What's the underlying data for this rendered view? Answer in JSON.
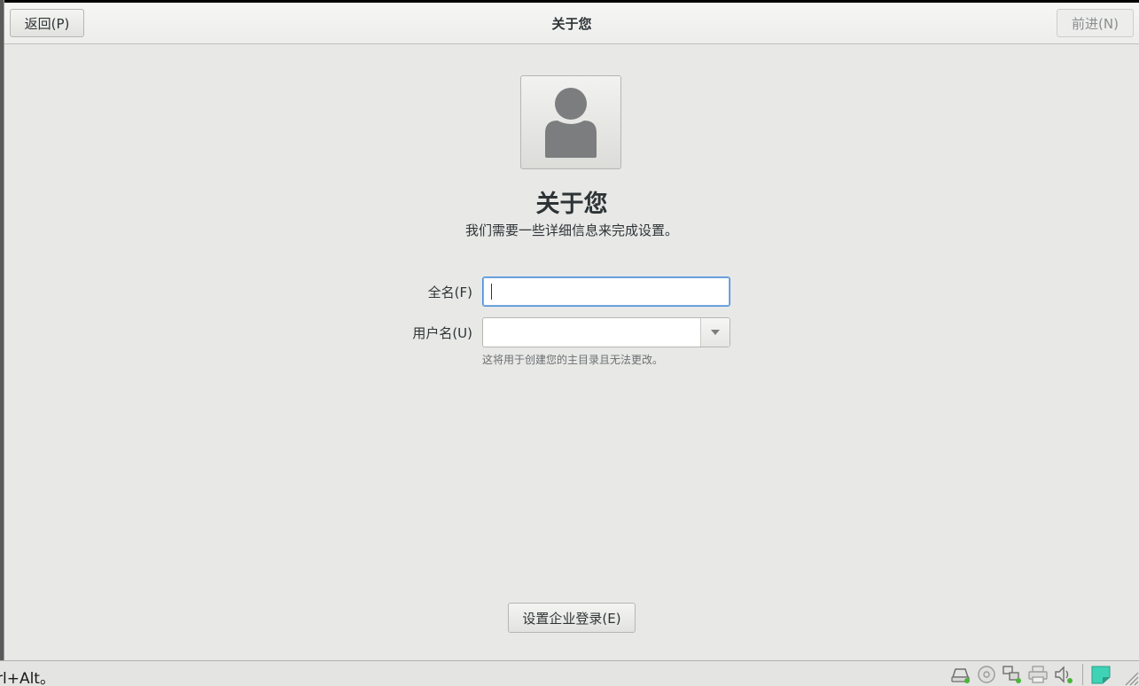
{
  "header": {
    "back_label": "返回(P)",
    "title": "关于您",
    "next_label": "前进(N)"
  },
  "main": {
    "heading": "关于您",
    "subtitle": "我们需要一些详细信息来完成设置。",
    "fullname": {
      "label": "全名(F)",
      "value": ""
    },
    "username": {
      "label": "用户名(U)",
      "value": "",
      "hint": "这将用于创建您的主目录且无法更改。"
    },
    "enterprise_login_label": "设置企业登录(E)"
  },
  "statusbar": {
    "hint_text": "rl+Alt。",
    "icons": [
      "hard-disk-icon",
      "optical-disc-icon",
      "network-icon",
      "printer-icon",
      "audio-icon",
      "shared-clipboard-icon"
    ]
  },
  "colors": {
    "focus_border": "#4a90d9",
    "background": "#e8e8e7",
    "tray_accent": "#3fd3b6"
  }
}
